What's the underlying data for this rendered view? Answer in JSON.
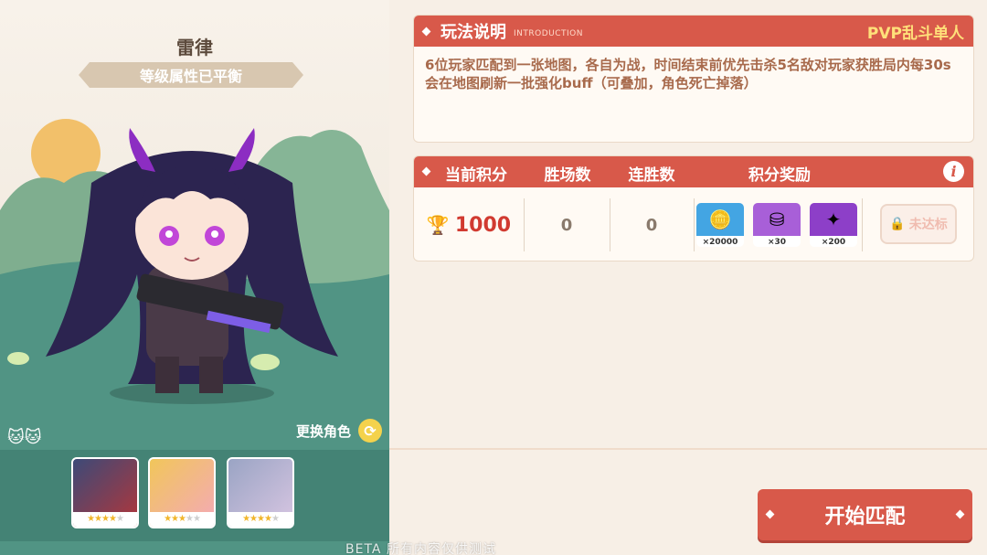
{
  "character": {
    "name": "雷律",
    "balance_label": "等级属性已平衡",
    "switch_label": "更换角色",
    "roster": [
      {
        "stars": 4,
        "max_stars": 5,
        "colors": [
          "#3c4a78",
          "#b2363a"
        ]
      },
      {
        "stars": 3,
        "max_stars": 5,
        "colors": [
          "#f1c65a",
          "#f4a9b8"
        ]
      },
      {
        "stars": 4,
        "max_stars": 5,
        "colors": [
          "#9aa4c4",
          "#d8c6e2"
        ]
      }
    ]
  },
  "intro": {
    "title": "玩法说明",
    "subtitle": "INTRODUCTION",
    "mode": "PVP乱斗单人",
    "text": "6位玩家匹配到一张地图，各自为战，时间结束前优先击杀5名敌对玩家获胜局内每30s会在地图刷新一批强化buff（可叠加，角色死亡掉落）"
  },
  "score": {
    "headers": {
      "points": "当前积分",
      "wins": "胜场数",
      "streak": "连胜数",
      "rewards": "积分奖励"
    },
    "points": "1000",
    "wins": "0",
    "streak": "0",
    "rewards": [
      {
        "qty": "×20000",
        "color": "#43a5e3",
        "icon": "gold-coin-icon"
      },
      {
        "qty": "×30",
        "color": "#a85fd8",
        "icon": "silver-ingot-icon"
      },
      {
        "qty": "×200",
        "color": "#8d3fc8",
        "icon": "crystal-orb-icon"
      }
    ],
    "status": "未达标"
  },
  "actions": {
    "start": "开始匹配"
  },
  "footer": {
    "beta": "BETA 所有内容仅供测试"
  },
  "colors": {
    "accent": "#d8594a",
    "score_red": "#d13a30"
  }
}
